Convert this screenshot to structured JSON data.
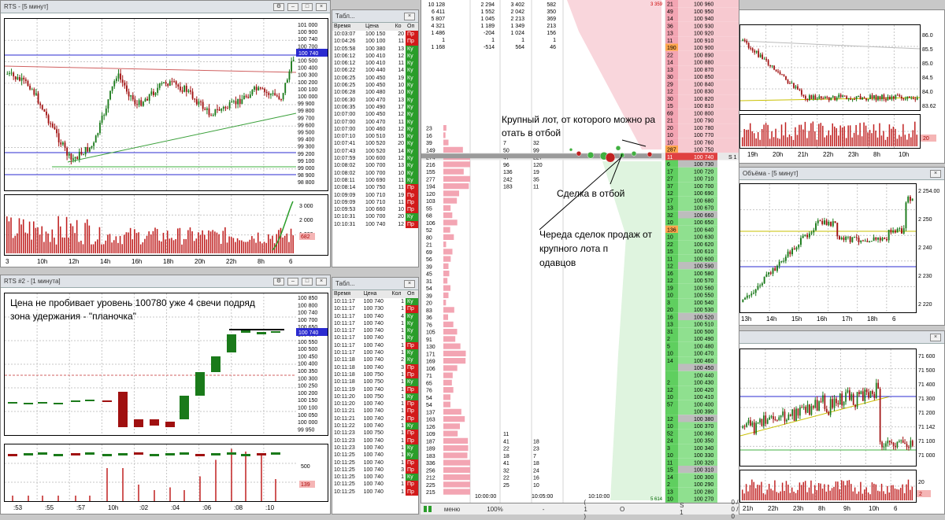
{
  "windows": {
    "rts5": {
      "title": "RTS - [5 минут]"
    },
    "rts1": {
      "title": "RTS #2 - [1 минута]"
    },
    "tape1": {
      "title": "Табл..."
    },
    "tape2": {
      "title": "Табл..."
    },
    "right_mid": {
      "title": "Объёма - [5 минут]"
    }
  },
  "rts5_chart": {
    "price_labels": [
      "101 000",
      "100 900",
      "100 740",
      "100 700",
      "100 600",
      "100 500",
      "100 400",
      "100 300",
      "100 200",
      "100 100",
      "100 000",
      "99 900",
      "99 800",
      "99 700",
      "99 600",
      "99 500",
      "99 400",
      "99 300",
      "99 200",
      "99 100",
      "99 000",
      "98 900",
      "98 800"
    ],
    "current_price": "100 740",
    "x_labels": [
      "3",
      "10h",
      "12h",
      "14h",
      "16h",
      "18h",
      "20h",
      "22h",
      "8h",
      "6"
    ],
    "vol_labels": [
      "3 000",
      "2 000",
      "1 000"
    ],
    "vol_badge": "682"
  },
  "rts1_chart": {
    "annotation_lines": [
      "Цена не пробивает уровень 100780 уже 4 свечи подряд",
      "зона удержания - \"планочка\""
    ],
    "price_labels": [
      "100 850",
      "100 800",
      "100 740",
      "100 700",
      "100 650",
      "100 600",
      "100 550",
      "100 500",
      "100 450",
      "100 400",
      "100 350",
      "100 300",
      "100 250",
      "100 200",
      "100 150",
      "100 100",
      "100 050",
      "100 000",
      "99 950"
    ],
    "x_labels": [
      ":53",
      ":55",
      ":57",
      "10h",
      ":02",
      ":04",
      ":06",
      ":08",
      ":10"
    ],
    "vol_label": "500",
    "vol_badge": "139"
  },
  "tape1": {
    "headers": [
      "Время",
      "Цена",
      "Ко",
      "Оп"
    ],
    "rows": [
      [
        "10:03:07",
        "100 150",
        "20",
        "Пр",
        "sell"
      ],
      [
        "10:04:26",
        "100 100",
        "11",
        "Пр",
        "sell"
      ],
      [
        "10:05:58",
        "100 380",
        "13",
        "Ку",
        "buy"
      ],
      [
        "10:06:12",
        "100 410",
        "12",
        "Ку",
        "buy"
      ],
      [
        "10:06:12",
        "100 410",
        "11",
        "Ку",
        "buy"
      ],
      [
        "10:06:22",
        "100 440",
        "14",
        "Ку",
        "buy"
      ],
      [
        "10:06:25",
        "100 450",
        "19",
        "Ку",
        "buy"
      ],
      [
        "10:06:25",
        "100 450",
        "10",
        "Ку",
        "buy"
      ],
      [
        "10:06:28",
        "100 480",
        "10",
        "Ку",
        "buy"
      ],
      [
        "10:06:30",
        "100 470",
        "13",
        "Ку",
        "buy"
      ],
      [
        "10:06:35",
        "100 490",
        "17",
        "Ку",
        "buy"
      ],
      [
        "10:07:00",
        "100 450",
        "12",
        "Ку",
        "buy"
      ],
      [
        "10:07:00",
        "100 470",
        "11",
        "Ку",
        "buy"
      ],
      [
        "10:07:00",
        "100 460",
        "12",
        "Ку",
        "buy"
      ],
      [
        "10:07:10",
        "100 510",
        "15",
        "Ку",
        "buy"
      ],
      [
        "10:07:41",
        "100 520",
        "20",
        "Ку",
        "buy"
      ],
      [
        "10:07:43",
        "100 520",
        "14",
        "Ку",
        "buy"
      ],
      [
        "10:07:59",
        "100 600",
        "12",
        "Ку",
        "buy"
      ],
      [
        "10:08:02",
        "100 700",
        "13",
        "Ку",
        "buy"
      ],
      [
        "10:08:02",
        "100 700",
        "10",
        "Ку",
        "buy"
      ],
      [
        "10:08:11",
        "100 690",
        "11",
        "Ку",
        "buy"
      ],
      [
        "10:08:14",
        "100 750",
        "11",
        "Пр",
        "sell"
      ],
      [
        "10:09:09",
        "100 710",
        "19",
        "Пр",
        "sell"
      ],
      [
        "10:09:09",
        "100 710",
        "11",
        "Пр",
        "sell"
      ],
      [
        "10:09:53",
        "100 660",
        "10",
        "Пр",
        "sell"
      ],
      [
        "10:10:31",
        "100 700",
        "20",
        "Ку",
        "buy"
      ],
      [
        "10:10:31",
        "100 740",
        "12",
        "Пр",
        "sell"
      ]
    ]
  },
  "tape2": {
    "headers": [
      "Время",
      "Цена",
      "Кол",
      "Оп"
    ],
    "rows": [
      [
        "10:11:17",
        "100 740",
        "1",
        "Ку",
        "buy"
      ],
      [
        "10:11:17",
        "100 730",
        "1",
        "Пр",
        "sell"
      ],
      [
        "10:11:17",
        "100 740",
        "4",
        "Ку",
        "buy"
      ],
      [
        "10:11:17",
        "100 740",
        "1",
        "Ку",
        "buy"
      ],
      [
        "10:11:17",
        "100 740",
        "1",
        "Ку",
        "buy"
      ],
      [
        "10:11:17",
        "100 740",
        "1",
        "Ку",
        "buy"
      ],
      [
        "10:11:17",
        "100 740",
        "1",
        "Пр",
        "sell"
      ],
      [
        "10:11:17",
        "100 740",
        "1",
        "Ку",
        "buy"
      ],
      [
        "10:11:18",
        "100 740",
        "2",
        "Ку",
        "buy"
      ],
      [
        "10:11:18",
        "100 740",
        "3",
        "Пр",
        "sell"
      ],
      [
        "10:11:18",
        "100 750",
        "1",
        "Пр",
        "sell"
      ],
      [
        "10:11:18",
        "100 750",
        "1",
        "Ку",
        "buy"
      ],
      [
        "10:11:19",
        "100 740",
        "1",
        "Пр",
        "sell"
      ],
      [
        "10:11:20",
        "100 750",
        "1",
        "Ку",
        "buy"
      ],
      [
        "10:11:20",
        "100 740",
        "1",
        "Пр",
        "sell"
      ],
      [
        "10:11:21",
        "100 740",
        "1",
        "Пр",
        "sell"
      ],
      [
        "10:11:21",
        "100 740",
        "2",
        "Пр",
        "sell"
      ],
      [
        "10:11:22",
        "100 740",
        "1",
        "Ку",
        "buy"
      ],
      [
        "10:11:23",
        "100 750",
        "1",
        "Пр",
        "sell"
      ],
      [
        "10:11:23",
        "100 740",
        "1",
        "Пр",
        "sell"
      ],
      [
        "10:11:23",
        "100 740",
        "1",
        "Ку",
        "buy"
      ],
      [
        "10:11:25",
        "100 740",
        "1",
        "Ку",
        "buy"
      ],
      [
        "10:11:25",
        "100 740",
        "1",
        "Пр",
        "sell"
      ],
      [
        "10:11:25",
        "100 740",
        "3",
        "Пр",
        "sell"
      ],
      [
        "10:11:25",
        "100 740",
        "1",
        "Ку",
        "buy"
      ],
      [
        "10:11:25",
        "100 740",
        "1",
        "Пр",
        "sell"
      ],
      [
        "10:11:25",
        "100 740",
        "1",
        "Пр",
        "sell"
      ]
    ]
  },
  "ladder": {
    "top_stats": [
      [
        "10 128",
        "2 294",
        "3 402",
        "582"
      ],
      [
        "6 411",
        "1 552",
        "2 042",
        "350"
      ],
      [
        "5 807",
        "1 045",
        "2 213",
        "369"
      ],
      [
        "4 321",
        "1 189",
        "1 349",
        "213"
      ],
      [
        "1 486",
        "-204",
        "1 024",
        "156"
      ],
      [
        "1",
        "1",
        "1",
        "1"
      ],
      [
        "1 168",
        "-514",
        "564",
        "46"
      ]
    ],
    "top_badge": "3 359",
    "bottom_badge": "5 614",
    "ask_rows": [
      [
        "21",
        "100 960"
      ],
      [
        "49",
        "100 950"
      ],
      [
        "14",
        "100 940"
      ],
      [
        "36",
        "100 930"
      ],
      [
        "13",
        "100 920"
      ],
      [
        "11",
        "100 910"
      ],
      [
        "190",
        "100 900"
      ],
      [
        "22",
        "100 890"
      ],
      [
        "14",
        "100 880"
      ],
      [
        "13",
        "100 870"
      ],
      [
        "30",
        "100 850"
      ],
      [
        "29",
        "100 840"
      ],
      [
        "12",
        "100 830"
      ],
      [
        "30",
        "100 820"
      ],
      [
        "15",
        "100 810"
      ],
      [
        "69",
        "100 800"
      ],
      [
        "21",
        "100 790"
      ],
      [
        "20",
        "100 780"
      ],
      [
        "10",
        "100 770"
      ],
      [
        "10",
        "100 760"
      ],
      [
        "287",
        "100 750"
      ]
    ],
    "best_ask": {
      "qty": "11",
      "price": "100 740",
      "marker": "S 1"
    },
    "bid_rows": [
      [
        "6",
        "100 730"
      ],
      [
        "17",
        "100 720"
      ],
      [
        "27",
        "100 710"
      ],
      [
        "37",
        "100 700"
      ],
      [
        "12",
        "100 690"
      ],
      [
        "17",
        "100 680"
      ],
      [
        "13",
        "100 670"
      ],
      [
        "32",
        "100 660"
      ],
      [
        "10",
        "100 650"
      ],
      [
        "136",
        "100 640"
      ],
      [
        "10",
        "100 630"
      ],
      [
        "22",
        "100 620"
      ],
      [
        "15",
        "100 610"
      ],
      [
        "11",
        "100 600"
      ],
      [
        "12",
        "100 590"
      ],
      [
        "16",
        "100 580"
      ],
      [
        "12",
        "100 570"
      ],
      [
        "19",
        "100 560"
      ],
      [
        "10",
        "100 550"
      ],
      [
        "3",
        "100 540"
      ],
      [
        "20",
        "100 530"
      ],
      [
        "16",
        "100 520"
      ],
      [
        "13",
        "100 510"
      ],
      [
        "31",
        "100 500"
      ],
      [
        "2",
        "100 490"
      ],
      [
        "5",
        "100 480"
      ],
      [
        "10",
        "100 470"
      ],
      [
        "14",
        "100 460"
      ],
      [
        "",
        "100 450"
      ],
      [
        "",
        "100 440"
      ],
      [
        "2",
        "100 430"
      ],
      [
        "12",
        "100 420"
      ],
      [
        "10",
        "100 410"
      ],
      [
        "57",
        "100 400"
      ],
      [
        "",
        "100 390"
      ],
      [
        "12",
        "100 380"
      ],
      [
        "10",
        "100 370"
      ],
      [
        "52",
        "100 360"
      ],
      [
        "24",
        "100 350"
      ],
      [
        "3",
        "100 340"
      ],
      [
        "10",
        "100 330"
      ],
      [
        "11",
        "100 320"
      ],
      [
        "15",
        "100 310"
      ],
      [
        "14",
        "100 300"
      ],
      [
        "2",
        "100 290"
      ],
      [
        "13",
        "100 280"
      ],
      [
        "10",
        "100 270"
      ],
      [
        "3",
        "100 260"
      ],
      [
        "3",
        "100 250"
      ]
    ],
    "left_cluster": [
      [
        "23",
        "",
        ""
      ],
      [
        "16",
        "",
        ""
      ],
      [
        "39",
        "7",
        "32"
      ],
      [
        "149",
        "50",
        "99"
      ],
      [
        "274",
        "47",
        "227"
      ],
      [
        "216",
        "96",
        "120"
      ],
      [
        "155",
        "136",
        "19"
      ],
      [
        "277",
        "242",
        "35"
      ],
      [
        "194",
        "183",
        "11"
      ],
      [
        "120",
        "",
        ""
      ],
      [
        "103",
        "",
        ""
      ],
      [
        "55",
        "",
        ""
      ],
      [
        "68",
        "",
        ""
      ],
      [
        "106",
        "",
        ""
      ],
      [
        "52",
        "",
        ""
      ],
      [
        "80",
        "",
        ""
      ],
      [
        "21",
        "",
        ""
      ],
      [
        "69",
        "",
        ""
      ],
      [
        "56",
        "",
        ""
      ],
      [
        "39",
        "",
        ""
      ],
      [
        "45",
        "",
        ""
      ],
      [
        "31",
        "",
        ""
      ],
      [
        "54",
        "",
        ""
      ],
      [
        "39",
        "",
        ""
      ],
      [
        "20",
        "",
        ""
      ],
      [
        "83",
        "",
        ""
      ],
      [
        "36",
        "",
        ""
      ],
      [
        "76",
        "",
        ""
      ],
      [
        "105",
        "",
        ""
      ],
      [
        "91",
        "",
        ""
      ],
      [
        "130",
        "",
        ""
      ],
      [
        "171",
        "",
        ""
      ],
      [
        "169",
        "",
        ""
      ],
      [
        "106",
        "",
        ""
      ],
      [
        "71",
        "",
        ""
      ],
      [
        "65",
        "",
        ""
      ],
      [
        "76",
        "",
        ""
      ],
      [
        "54",
        "",
        ""
      ],
      [
        "54",
        "",
        ""
      ],
      [
        "137",
        "",
        ""
      ],
      [
        "163",
        "",
        ""
      ],
      [
        "126",
        "",
        ""
      ],
      [
        "109",
        "11",
        ""
      ],
      [
        "187",
        "41",
        "18"
      ],
      [
        "189",
        "22",
        "23"
      ],
      [
        "183",
        "18",
        "7"
      ],
      [
        "336",
        "41",
        "18"
      ],
      [
        "256",
        "32",
        "24"
      ],
      [
        "212",
        "22",
        "16"
      ],
      [
        "225",
        "25",
        "10"
      ],
      [
        "215",
        "",
        ""
      ]
    ],
    "time_labels": [
      "10:00:00",
      "10:05:00",
      "10:10:00"
    ],
    "annotations": {
      "big_lot": "Крупный лот, от которого можно работать в отбой",
      "bounce": "Сделка в отбой",
      "sells": "Череда сделок продаж от крупного лота продавцов"
    }
  },
  "status_bar": {
    "menu": "меню",
    "zoom": "100%",
    "one": "-",
    "paren": "( 1 )",
    "circle": "O",
    "s1": "S 1",
    "counts": "0 / 0 / 0"
  },
  "right_top": {
    "price_labels": [
      "86.0",
      "85.5",
      "85.0",
      "84.5",
      "84.0",
      "83.62"
    ],
    "x_labels": [
      "19h",
      "20h",
      "21h",
      "22h",
      "23h",
      "8h",
      "10h"
    ],
    "vol_label": "20",
    "vol_badge": "1"
  },
  "right_mid_chart": {
    "price_labels": [
      "2 254.00",
      "2 250",
      "2 240",
      "2 230",
      "2 220"
    ],
    "x_labels": [
      "13h",
      "14h",
      "15h",
      "16h",
      "17h",
      "18h",
      "6"
    ]
  },
  "right_bot": {
    "price_labels": [
      "71 600",
      "71 500",
      "71 400",
      "71 300",
      "71 200",
      "71 142",
      "71 100",
      "71 000"
    ],
    "x_labels": [
      "21h",
      "22h",
      "23h",
      "8h",
      "9h",
      "10h",
      "6"
    ],
    "vol_label": "20",
    "vol_badge": "2"
  },
  "colors": {
    "buy": "#2a9d2a",
    "sell": "#d21a1a",
    "ask_bg": "#f7c9d0",
    "bid_bg": "#bfeabf",
    "price_grey": "#d0d0d0",
    "highlight": "#ff8c00"
  }
}
